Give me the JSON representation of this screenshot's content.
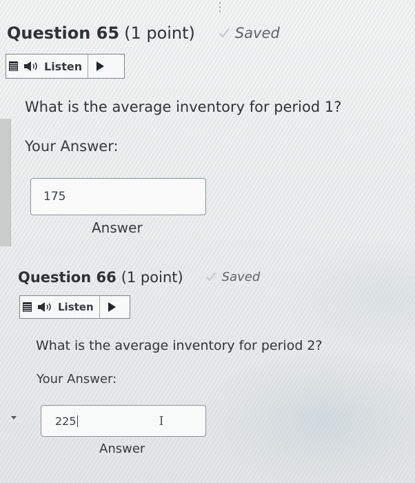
{
  "q65": {
    "title": "Question 65",
    "points": "(1 point)",
    "saved": "Saved",
    "listen": "Listen",
    "text": "What is the average inventory for period 1?",
    "your_answer_label": "Your Answer:",
    "answer_value": "175",
    "answer_label": "Answer"
  },
  "q66": {
    "title": "Question 66",
    "points": "(1 point)",
    "saved": "Saved",
    "listen": "Listen",
    "text": "What is the average inventory for period 2?",
    "your_answer_label": "Your Answer:",
    "answer_value": "225",
    "answer_label": "Answer"
  },
  "icons": {
    "check": "check-icon",
    "speaker": "speaker-icon",
    "menu": "menu-icon",
    "play": "play-icon",
    "cursor": "text-cursor-icon"
  },
  "colors": {
    "text": "#2f3437",
    "saved_check": "#c6cbcf",
    "border": "#8c9296"
  }
}
